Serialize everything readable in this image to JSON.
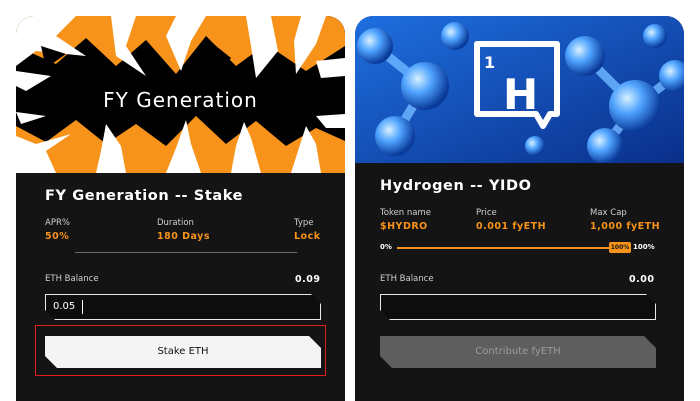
{
  "stake_card": {
    "banner_title": "FY Generation",
    "title": "FY Generation -- Stake",
    "stats": [
      {
        "label": "APR%",
        "value": "50%"
      },
      {
        "label": "Duration",
        "value": "180 Days"
      },
      {
        "label": "Type",
        "value": "Lock"
      }
    ],
    "balance_label": "ETH Balance",
    "balance_value": "0.09",
    "input_value": "0.05",
    "button_label": "Stake ETH"
  },
  "ido_card": {
    "title": "Hydrogen -- YIDO",
    "banner_letter": "H",
    "banner_number": "1",
    "stats": [
      {
        "label": "Token name",
        "value": "$HYDRO"
      },
      {
        "label": "Price",
        "value": "0.001 fyETH"
      },
      {
        "label": "Max Cap",
        "value": "1,000 fyETH"
      }
    ],
    "progress": {
      "min_label": "0%",
      "thumb_label": "100%",
      "max_label": "100%",
      "fraction": 1.0
    },
    "balance_label": "ETH Balance",
    "balance_value": "0.00",
    "input_value": "",
    "button_label": "Contribute fyETH"
  },
  "colors": {
    "accent": "#f7931a",
    "card_bg": "#141414",
    "highlight": "#e01e1e",
    "banner_blue": "#1a63c9"
  }
}
